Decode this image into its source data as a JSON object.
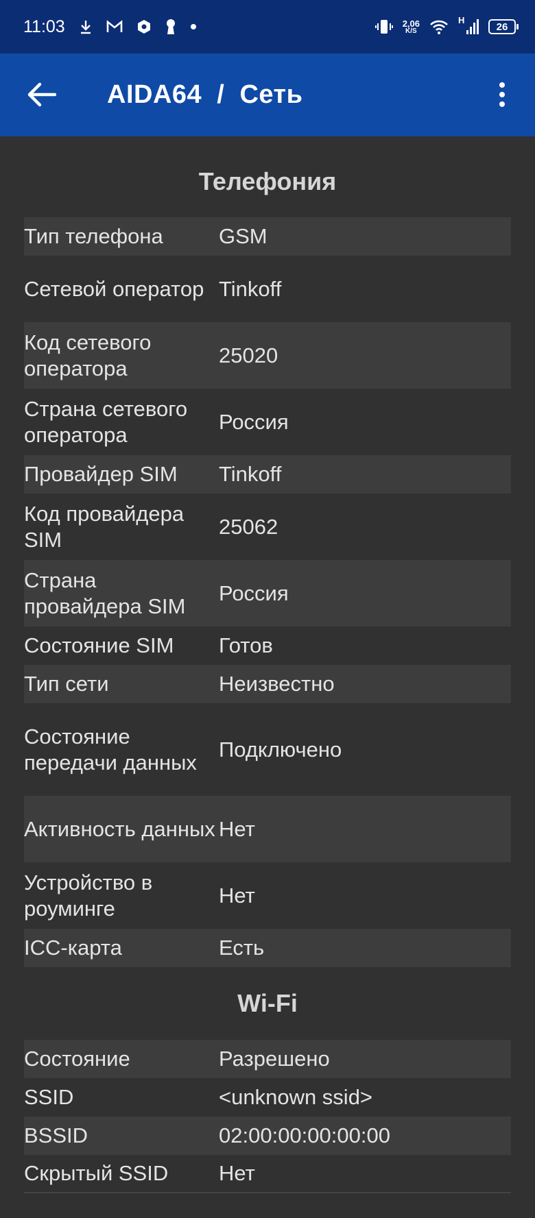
{
  "status_bar": {
    "time": "11:03",
    "net_speed_value": "2,06",
    "net_speed_unit": "K/S",
    "network_type": "H",
    "battery": "26",
    "icons_left": [
      "download-icon",
      "gmail-icon",
      "shield-icon",
      "keyhole-icon",
      "dot-icon"
    ],
    "icons_right": [
      "vibrate-icon",
      "wifi-icon",
      "signal-icon",
      "battery-icon"
    ]
  },
  "app_bar": {
    "title": "AIDA64  /  Сеть",
    "color": "#0f4aa6"
  },
  "telephony": {
    "title": "Телефония",
    "rows": [
      {
        "key": "Тип телефона",
        "value": "GSM"
      },
      {
        "key": "Сетевой оператор",
        "value": "Tinkoff"
      },
      {
        "key": "Код сетевого оператора",
        "value": "25020"
      },
      {
        "key": "Страна сетевого оператора",
        "value": "Россия"
      },
      {
        "key": "Провайдер SIM",
        "value": "Tinkoff"
      },
      {
        "key": "Код провайдера SIM",
        "value": "25062"
      },
      {
        "key": "Страна провайдера SIM",
        "value": "Россия"
      },
      {
        "key": "Состояние SIM",
        "value": "Готов"
      },
      {
        "key": "Тип сети",
        "value": "Неизвестно"
      },
      {
        "key": "Состояние передачи данных",
        "value": "Подключено"
      },
      {
        "key": "Активность данных",
        "value": "Нет"
      },
      {
        "key": "Устройство в роуминге",
        "value": "Нет"
      },
      {
        "key": "ICC-карта",
        "value": "Есть"
      }
    ]
  },
  "wifi": {
    "title": "Wi-Fi",
    "rows": [
      {
        "key": "Состояние",
        "value": "Разрешено"
      },
      {
        "key": "SSID",
        "value": "<unknown ssid>"
      },
      {
        "key": "BSSID",
        "value": "02:00:00:00:00:00"
      },
      {
        "key": "Скрытый SSID",
        "value": "Нет"
      }
    ]
  }
}
